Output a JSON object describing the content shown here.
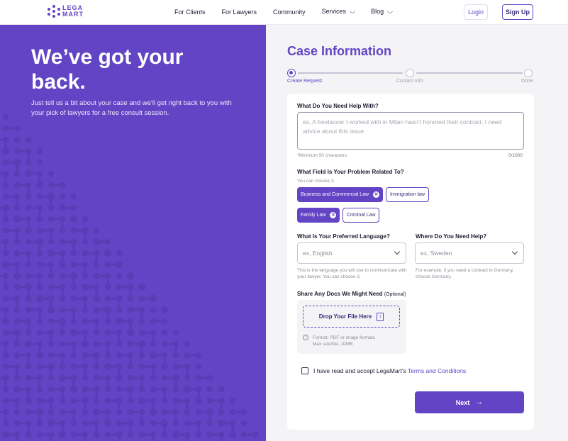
{
  "nav": {
    "logo_top": "LEGA",
    "logo_bottom": "MART",
    "links": [
      "For Clients",
      "For Lawyers",
      "Community"
    ],
    "services_label": "Services",
    "blog_label": "Blog",
    "login_label": "Login",
    "signup_label": "Sign Up"
  },
  "hero": {
    "title_line1": "We’ve got your",
    "title_line2": "back.",
    "subtitle": "Just tell us a bit about your case and we'll get right back to you with your pick of lawyers for a free consult session."
  },
  "case": {
    "title": "Case Information",
    "steps": [
      "Create Request",
      "Contact Info",
      "Done"
    ],
    "help_label": "What Do You Need Help With?",
    "help_placeholder": "ex, A freelancer I worked with in Milan hasn't honored their contract. I need advice about this issue.",
    "help_min_hint": "*Minimum 50 characters",
    "help_counter": "0/1000",
    "field_label": "What Field Is Your Problem Related To?",
    "field_hint": "You can choose 3.",
    "chips": {
      "business": "Business and Commercial Law",
      "immigration": "Immigration law",
      "family": "Family Law",
      "criminal": "Criminal Law"
    },
    "language_label": "What Is Your Preferred Language?",
    "language_placeholder": "ex, English",
    "language_hint": "This is the language you will use to communicate with your lawyer. You can choose 3.",
    "location_label": "Where Do You Need Help?",
    "location_placeholder": "ex, Sweden",
    "location_hint": "For example, if you need a contract in Germany, choose Germany.",
    "docs_label": "Share Any Docs We Might Need",
    "docs_optional": "(Optional)",
    "drop_label": "Drop Your File Here",
    "format_hint": "Format: PDF or image formats",
    "size_hint": "Max size/file: 10MB",
    "terms_text": "I have read and accept LegaMart’s",
    "terms_link": "Terms and Conditions",
    "next_label": "Next"
  },
  "colors": {
    "brand": "#6244c5",
    "dark": "#1e1b2e",
    "muted": "#8e8b99"
  }
}
